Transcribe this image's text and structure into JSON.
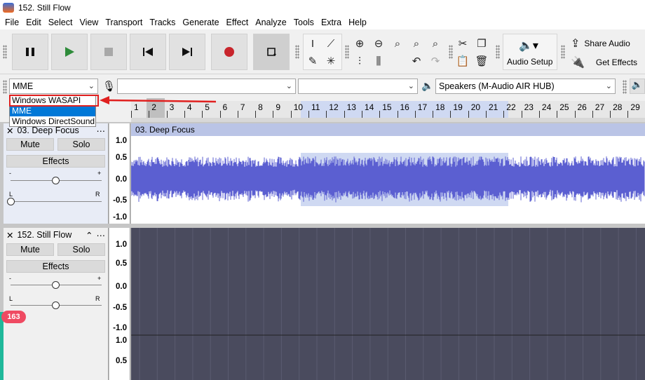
{
  "window": {
    "title": "152. Still Flow"
  },
  "menu": [
    "File",
    "Edit",
    "Select",
    "View",
    "Transport",
    "Tracks",
    "Generate",
    "Effect",
    "Analyze",
    "Tools",
    "Extra",
    "Help"
  ],
  "toolbar": {
    "audio_setup_label": "Audio Setup",
    "share_audio_label": "Share Audio",
    "get_effects_label": "Get Effects"
  },
  "device_bar": {
    "host_value": "MME",
    "recording_device_value": "",
    "channels_value": "",
    "playback_device_value": "Speakers (M-Audio AIR HUB)"
  },
  "host_dropdown": {
    "options": [
      "Windows WASAPI",
      "MME",
      "Windows DirectSound"
    ],
    "selected": "MME",
    "highlighted": "Windows WASAPI"
  },
  "ruler": {
    "ticks": [
      "1",
      "2",
      "3",
      "4",
      "5",
      "6",
      "7",
      "8",
      "9",
      "10",
      "11",
      "12",
      "13",
      "14",
      "15",
      "16",
      "17",
      "18",
      "19",
      "20",
      "21",
      "22",
      "23",
      "24",
      "25",
      "26",
      "27",
      "28",
      "29"
    ],
    "selection_start": 11,
    "selection_end": 22
  },
  "tracks": [
    {
      "name": "03. Deep Focus",
      "clip_name": "03. Deep Focus",
      "mute_label": "Mute",
      "solo_label": "Solo",
      "effects_label": "Effects",
      "gain_minus": "-",
      "gain_plus": "+",
      "pan_left": "L",
      "pan_right": "R",
      "scale": [
        "1.0",
        "0.5",
        "0.0",
        "-0.5",
        "-1.0"
      ]
    },
    {
      "name": "152. Still Flow",
      "mute_label": "Mute",
      "solo_label": "Solo",
      "effects_label": "Effects",
      "gain_minus": "-",
      "gain_plus": "+",
      "pan_left": "L",
      "pan_right": "R",
      "scale": [
        "1.0",
        "0.5",
        "0.0",
        "-0.5",
        "-1.0",
        "1.0",
        "0.5"
      ]
    }
  ],
  "badge": {
    "count": "163"
  },
  "colors": {
    "waveform": "#5b5fd1",
    "selection": "#cfd9f2",
    "highlight": "#e0201f",
    "badge": "#ef4a62"
  }
}
